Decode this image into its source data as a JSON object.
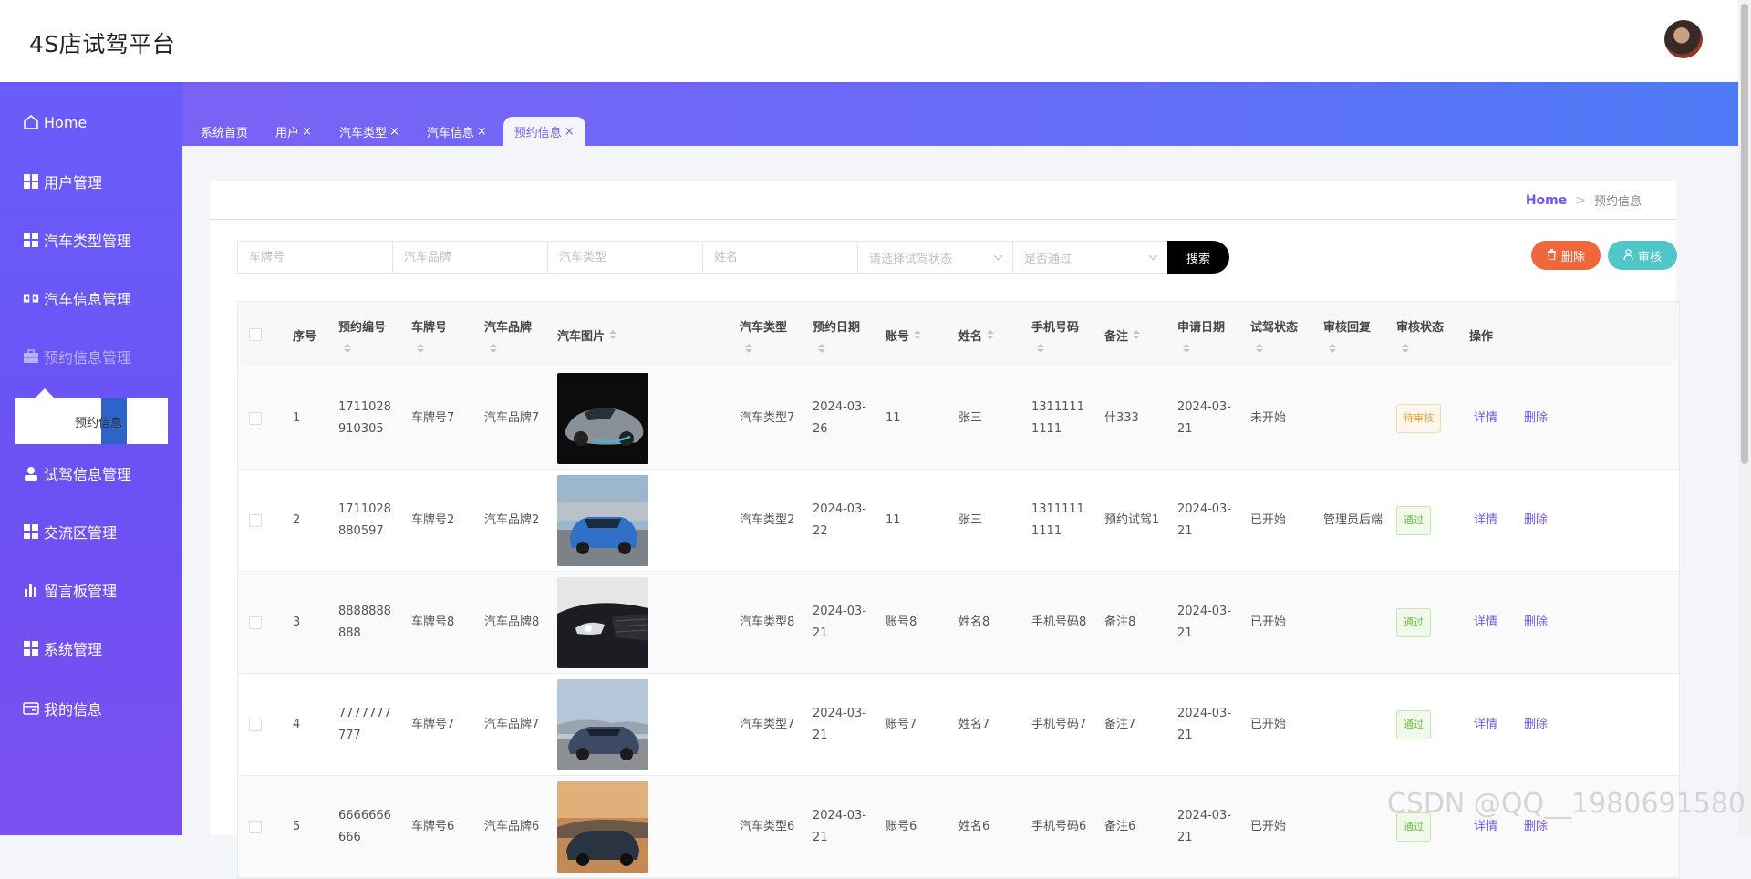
{
  "header": {
    "title": "4S店试驾平台"
  },
  "sidebar": {
    "items": [
      {
        "label": "Home",
        "icon": "home-icon"
      },
      {
        "label": "用户管理",
        "icon": "grid-icon"
      },
      {
        "label": "汽车类型管理",
        "icon": "grid-icon"
      },
      {
        "label": "汽车信息管理",
        "icon": "car-icon"
      },
      {
        "label": "预约信息管理",
        "icon": "briefcase-icon"
      },
      {
        "label": "试驾信息管理",
        "icon": "user-icon"
      },
      {
        "label": "交流区管理",
        "icon": "grid-icon"
      },
      {
        "label": "留言板管理",
        "icon": "bar-chart-icon"
      },
      {
        "label": "系统管理",
        "icon": "grid-icon"
      },
      {
        "label": "我的信息",
        "icon": "id-card-icon"
      }
    ],
    "submenu": {
      "label": "预约信息"
    }
  },
  "tabs": [
    {
      "label": "系统首页",
      "closable": false
    },
    {
      "label": "用户",
      "closable": true
    },
    {
      "label": "汽车类型",
      "closable": true
    },
    {
      "label": "汽车信息",
      "closable": true
    },
    {
      "label": "预约信息",
      "closable": true,
      "active": true
    }
  ],
  "tab_close_glyph": "×",
  "breadcrumb": {
    "home": "Home",
    "separator": ">",
    "current": "预约信息"
  },
  "search": {
    "plate_placeholder": "车牌号",
    "brand_placeholder": "汽车品牌",
    "type_placeholder": "汽车类型",
    "name_placeholder": "姓名",
    "status_placeholder": "请选择试驾状态",
    "pass_placeholder": "是否通过",
    "button": "搜索"
  },
  "actions": {
    "delete": "删除",
    "audit": "审核"
  },
  "table": {
    "headers": {
      "index": "序号",
      "booking_no": "预约编号",
      "plate": "车牌号",
      "brand": "汽车品牌",
      "image": "汽车图片",
      "type": "汽车类型",
      "date": "预约日期",
      "account": "账号",
      "name": "姓名",
      "phone": "手机号码",
      "remark": "备注",
      "apply_date": "申请日期",
      "drive_status": "试驾状态",
      "audit_reply": "审核回复",
      "audit_status": "审核状态",
      "ops": "操作"
    },
    "rows": [
      {
        "index": "1",
        "booking_no": "1711028910305",
        "plate": "车牌号7",
        "brand": "汽车品牌7",
        "image": "silver-sports-car",
        "type": "汽车类型7",
        "date": "2024-03-26",
        "account": "11",
        "name": "张三",
        "phone": "13111111111",
        "remark": "什333",
        "apply_date": "2024-03-21",
        "drive_status": "未开始",
        "audit_reply": "",
        "audit_status": "待审核",
        "audit_kind": "wait",
        "detail": "详情",
        "delete": "删除"
      },
      {
        "index": "2",
        "booking_no": "1711028880597",
        "plate": "车牌号2",
        "brand": "汽车品牌2",
        "image": "blue-suv",
        "type": "汽车类型2",
        "date": "2024-03-22",
        "account": "11",
        "name": "张三",
        "phone": "13111111111",
        "remark": "预约试驾1",
        "apply_date": "2024-03-21",
        "drive_status": "已开始",
        "audit_reply": "管理员后端",
        "audit_status": "通过",
        "audit_kind": "pass",
        "detail": "详情",
        "delete": "删除"
      },
      {
        "index": "3",
        "booking_no": "8888888888",
        "plate": "车牌号8",
        "brand": "汽车品牌8",
        "image": "dark-car-headlight",
        "type": "汽车类型8",
        "date": "2024-03-21",
        "account": "账号8",
        "name": "姓名8",
        "phone": "手机号码8",
        "remark": "备注8",
        "apply_date": "2024-03-21",
        "drive_status": "已开始",
        "audit_reply": "",
        "audit_status": "通过",
        "audit_kind": "pass",
        "detail": "详情",
        "delete": "删除"
      },
      {
        "index": "4",
        "booking_no": "7777777777",
        "plate": "车牌号7",
        "brand": "汽车品牌7",
        "image": "grey-suv",
        "type": "汽车类型7",
        "date": "2024-03-21",
        "account": "账号7",
        "name": "姓名7",
        "phone": "手机号码7",
        "remark": "备注7",
        "apply_date": "2024-03-21",
        "drive_status": "已开始",
        "audit_reply": "",
        "audit_status": "通过",
        "audit_kind": "pass",
        "detail": "详情",
        "delete": "删除"
      },
      {
        "index": "5",
        "booking_no": "6666666666",
        "plate": "车牌号6",
        "brand": "汽车品牌6",
        "image": "suv-sunset",
        "type": "汽车类型6",
        "date": "2024-03-21",
        "account": "账号6",
        "name": "姓名6",
        "phone": "手机号码6",
        "remark": "备注6",
        "apply_date": "2024-03-21",
        "drive_status": "已开始",
        "audit_reply": "",
        "audit_status": "通过",
        "audit_kind": "pass",
        "detail": "详情",
        "delete": "删除"
      }
    ]
  },
  "watermark": "CSDN @QQ__1980691580",
  "colors": {
    "accent": "#7257e8",
    "delete": "#f0673e",
    "audit": "#4fc6c8",
    "sidebar": "#6b58f6"
  }
}
